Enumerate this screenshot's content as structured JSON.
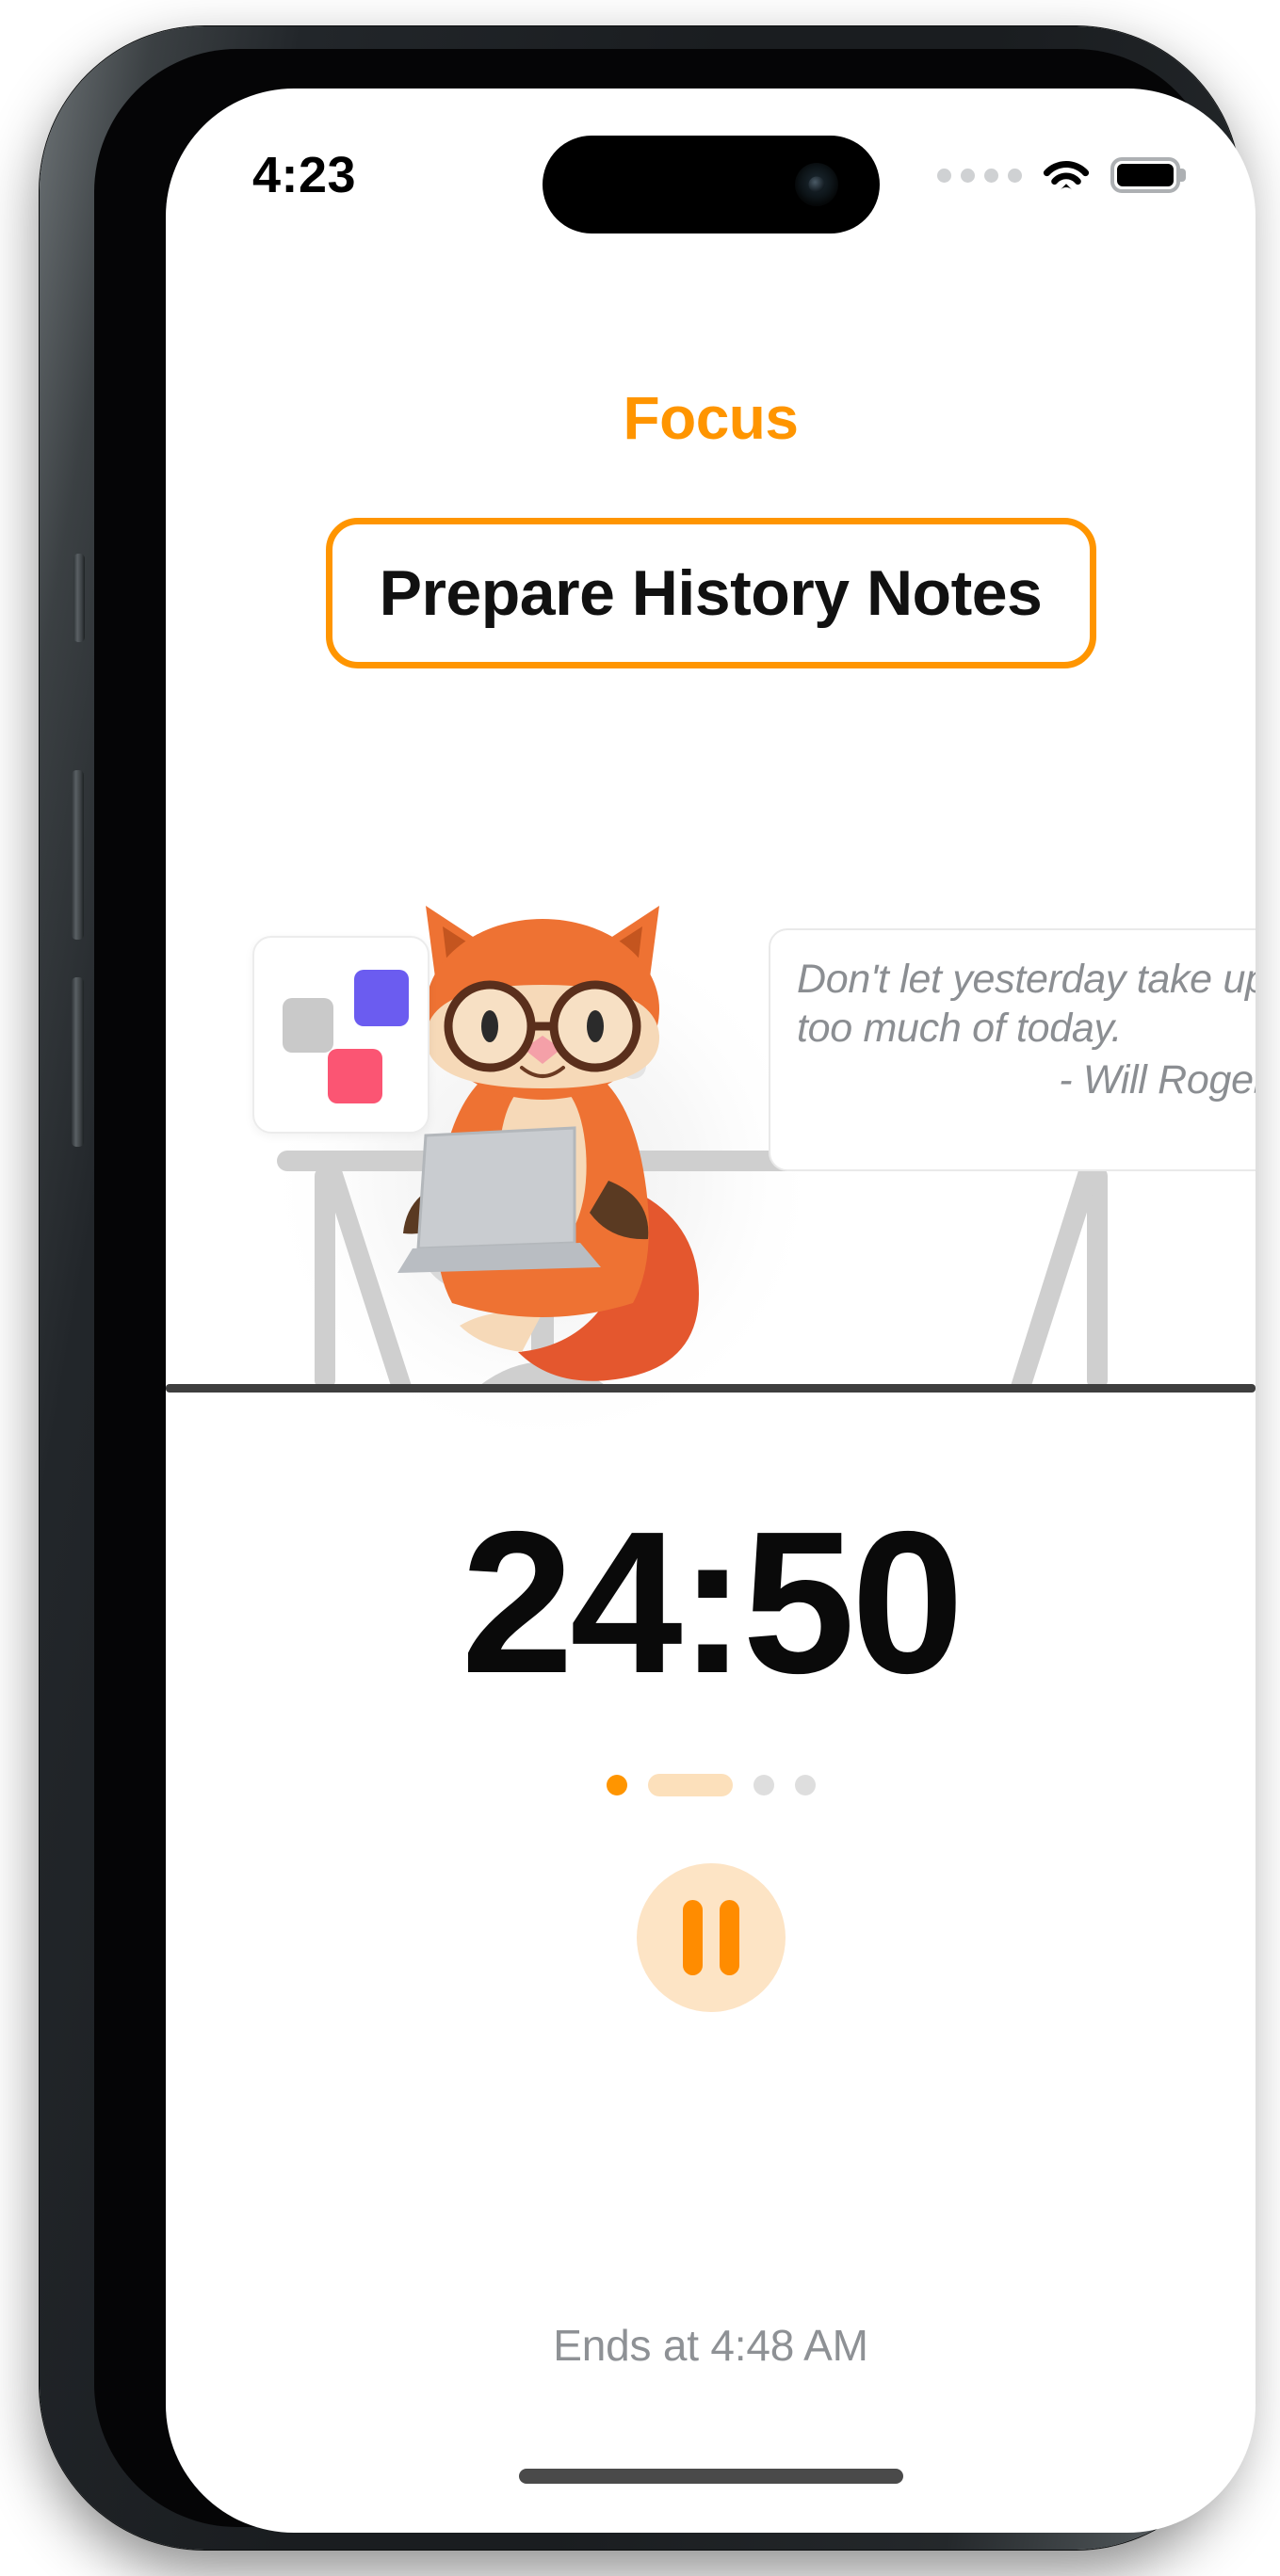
{
  "status_bar": {
    "time": "4:23",
    "cellular_dots": 4,
    "wifi_icon": "wifi-icon",
    "battery_icon": "battery-full-icon"
  },
  "header": {
    "title": "Focus",
    "accent_color": "#FF9500"
  },
  "task": {
    "label": "Prepare History Notes",
    "border_color": "#FF9500"
  },
  "widget": {
    "name": "app-blocking-widget",
    "squares": [
      {
        "name": "widget-square-gray",
        "color": "#c9c9c9"
      },
      {
        "name": "widget-square-blue",
        "color": "#6b5cf0"
      },
      {
        "name": "widget-square-pink",
        "color": "#fb5573"
      }
    ]
  },
  "quote": {
    "line1": "Don't let yesterday take up",
    "line2": "too much of today.",
    "author": "- Will Rogers",
    "text_color": "#8b8e92"
  },
  "illustration": {
    "name": "fox-at-desk-illustration",
    "subject": "fox-with-glasses-using-laptop",
    "desk_color": "#cfcfcf",
    "floor_line_color": "#3e3e3e",
    "fox_color": "#ee7233",
    "dot_grid_columns": 4,
    "dot_grid_rows": 3
  },
  "timer": {
    "display": "24:50",
    "minutes": 24,
    "seconds": 50
  },
  "session_progress": {
    "steps": [
      {
        "name": "session-step-completed",
        "type": "dot",
        "color": "#FF9500"
      },
      {
        "name": "session-step-active",
        "type": "pill",
        "color": "#FCE0BB"
      },
      {
        "name": "session-step-upcoming-1",
        "type": "dot",
        "color": "#dedede"
      },
      {
        "name": "session-step-upcoming-2",
        "type": "dot",
        "color": "#dedede"
      }
    ]
  },
  "controls": {
    "pause_label": "Pause",
    "pause_icon": "pause-icon",
    "button_bg": "#FDE4C5",
    "icon_color": "#FF8C00"
  },
  "footer": {
    "ends_at": "Ends at 4:48 AM"
  }
}
